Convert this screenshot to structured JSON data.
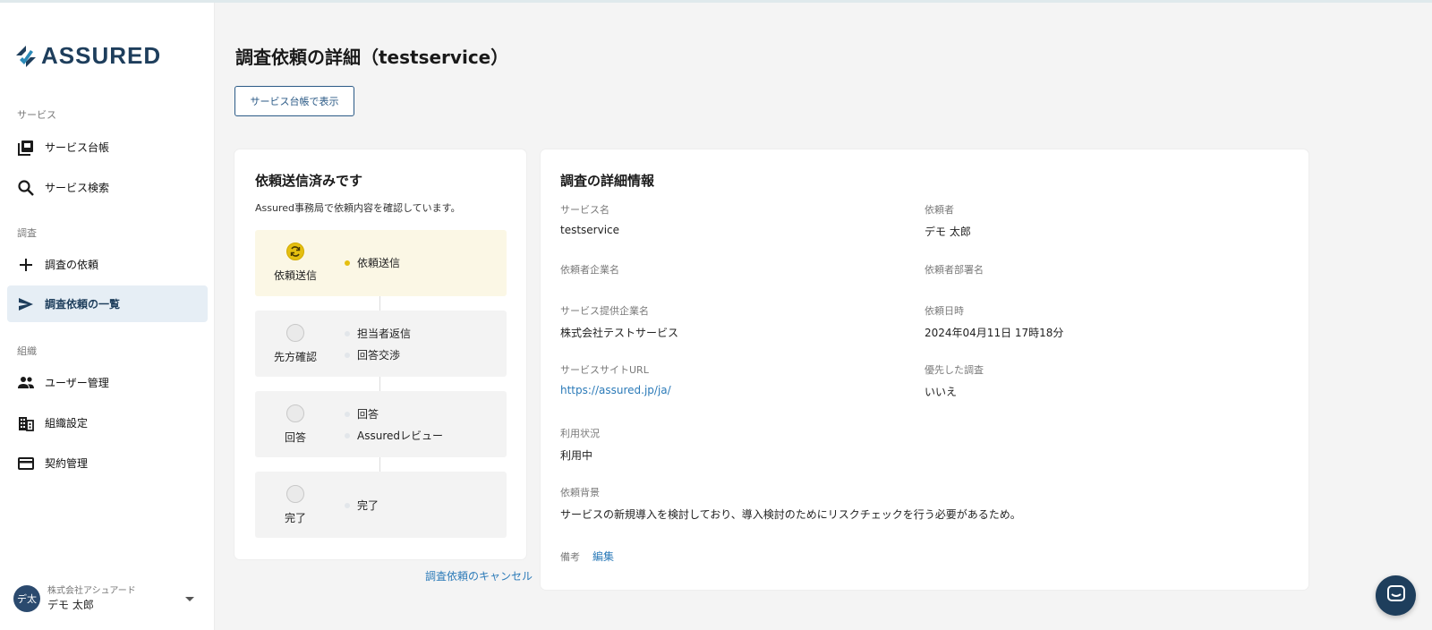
{
  "brand": {
    "name": "ASSURED"
  },
  "sidebar": {
    "section_service": "サービス",
    "section_survey": "調査",
    "section_org": "組織",
    "items": [
      {
        "label": "サービス台帳",
        "icon": "library-icon"
      },
      {
        "label": "サービス検索",
        "icon": "search-icon"
      },
      {
        "label": "調査の依頼",
        "icon": "plus-icon"
      },
      {
        "label": "調査依頼の一覧",
        "icon": "send-icon"
      },
      {
        "label": "ユーザー管理",
        "icon": "people-icon"
      },
      {
        "label": "組織設定",
        "icon": "building-icon"
      },
      {
        "label": "契約管理",
        "icon": "card-icon"
      }
    ],
    "active_index": 3
  },
  "user": {
    "avatar_initials": "デ太",
    "company": "株式会社アシュアード",
    "name": "デモ 太郎"
  },
  "page": {
    "title": "調査依頼の詳細（testservice）",
    "view_button": "サービス台帳で表示"
  },
  "status_card": {
    "title": "依頼送信済みです",
    "subtitle": "Assured事務局で依頼内容を確認しています。",
    "steps": [
      {
        "label": "依頼送信",
        "substeps": [
          "依頼送信"
        ],
        "state": "current"
      },
      {
        "label": "先方確認",
        "substeps": [
          "担当者返信",
          "回答交渉"
        ],
        "state": "pending"
      },
      {
        "label": "回答",
        "substeps": [
          "回答",
          "Assuredレビュー"
        ],
        "state": "pending"
      },
      {
        "label": "完了",
        "substeps": [
          "完了"
        ],
        "state": "pending"
      }
    ],
    "cancel_link": "調査依頼のキャンセル"
  },
  "details": {
    "title": "調査の詳細情報",
    "service_name_label": "サービス名",
    "service_name": "testservice",
    "requester_label": "依頼者",
    "requester": "デモ 太郎",
    "requester_company_label": "依頼者企業名",
    "requester_company": "",
    "requester_dept_label": "依頼者部署名",
    "requester_dept": "",
    "provider_label": "サービス提供企業名",
    "provider": "株式会社テストサービス",
    "request_date_label": "依頼日時",
    "request_date": "2024年04月11日 17時18分",
    "site_url_label": "サービスサイトURL",
    "site_url": "https://assured.jp/ja/",
    "priority_label": "優先した調査",
    "priority": "いいえ",
    "usage_label": "利用状況",
    "usage": "利用中",
    "background_label": "依頼背景",
    "background": "サービスの新規導入を検討しており、導入検討のためにリスクチェックを行う必要があるため。",
    "note_label": "備考",
    "edit_link": "編集"
  },
  "colors": {
    "brand": "#1e3e5c",
    "accent_link": "#2b7ab8",
    "current_step": "#e5bf10",
    "active_nav_bg": "#e6eef5"
  }
}
